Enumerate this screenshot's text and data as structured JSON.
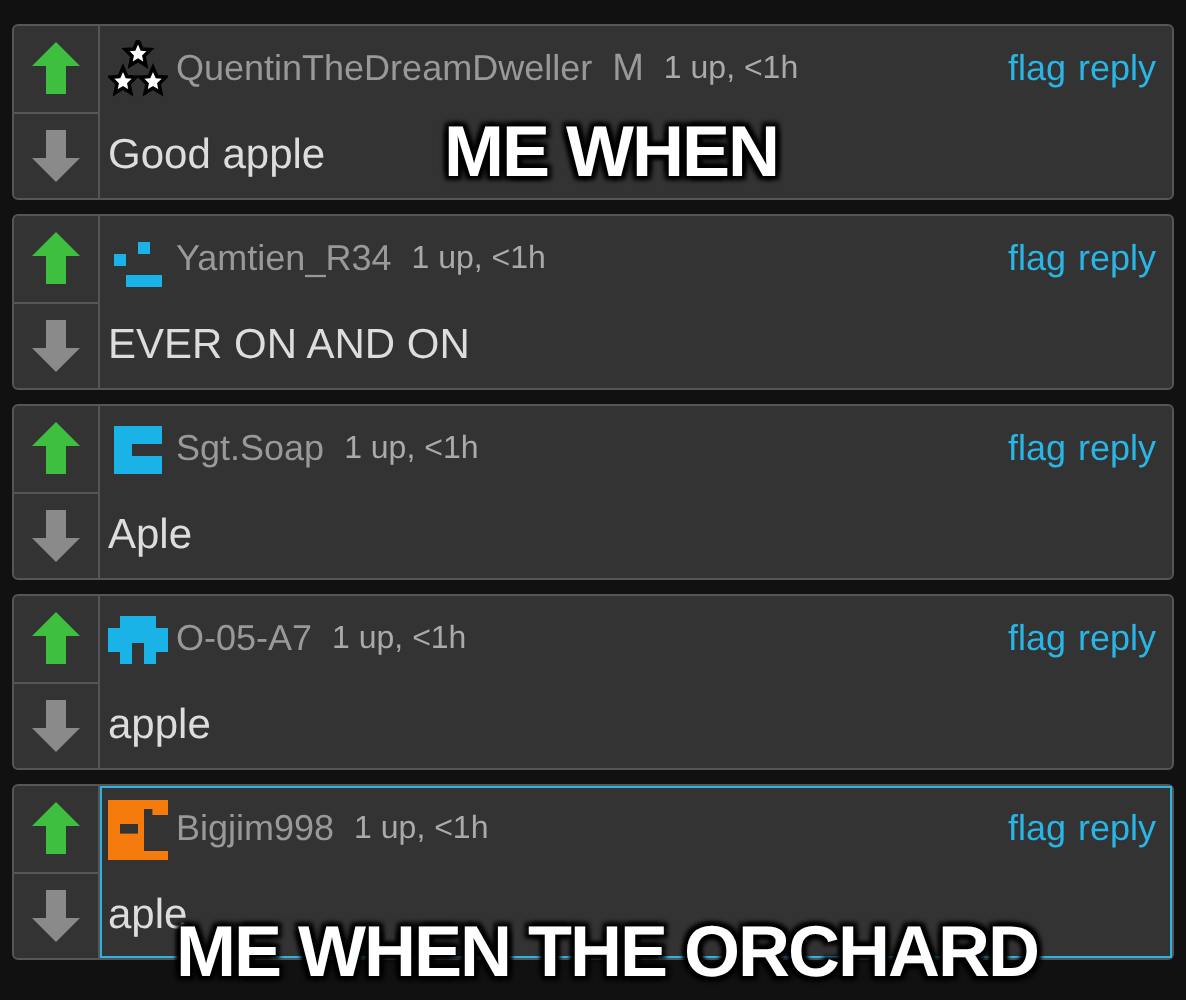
{
  "comments": [
    {
      "kind": "stars",
      "user": "QuentinTheDreamDweller",
      "badge": "M",
      "meta": "1 up, <1h",
      "actions": [
        "flag",
        "reply"
      ],
      "text": "Good apple",
      "upvoted": true,
      "highlighted": false
    },
    {
      "kind": "dashes",
      "color": "#1ab3e8",
      "user": "Yamtien_R34",
      "meta": "1 up, <1h",
      "actions": [
        "flag",
        "reply"
      ],
      "text": "EVER ON AND ON",
      "upvoted": true,
      "highlighted": false
    },
    {
      "kind": "block",
      "color": "#1ab3e8",
      "user": "Sgt.Soap",
      "meta": "1 up, <1h",
      "actions": [
        "flag",
        "reply"
      ],
      "text": "Aple",
      "upvoted": true,
      "highlighted": false
    },
    {
      "kind": "invader",
      "color": "#1ab3e8",
      "user": "O-05-A7",
      "meta": "1 up, <1h",
      "actions": [
        "flag",
        "reply"
      ],
      "text": "apple",
      "upvoted": true,
      "highlighted": false
    },
    {
      "kind": "bracket",
      "color": "#f57c0c",
      "user": "Bigjim998",
      "meta": "1 up, <1h",
      "actions": [
        "flag",
        "reply"
      ],
      "text": "aple",
      "upvoted": true,
      "highlighted": true
    }
  ],
  "captions": [
    "ME WHEN",
    "ME WHEN THE ORCHARD"
  ]
}
